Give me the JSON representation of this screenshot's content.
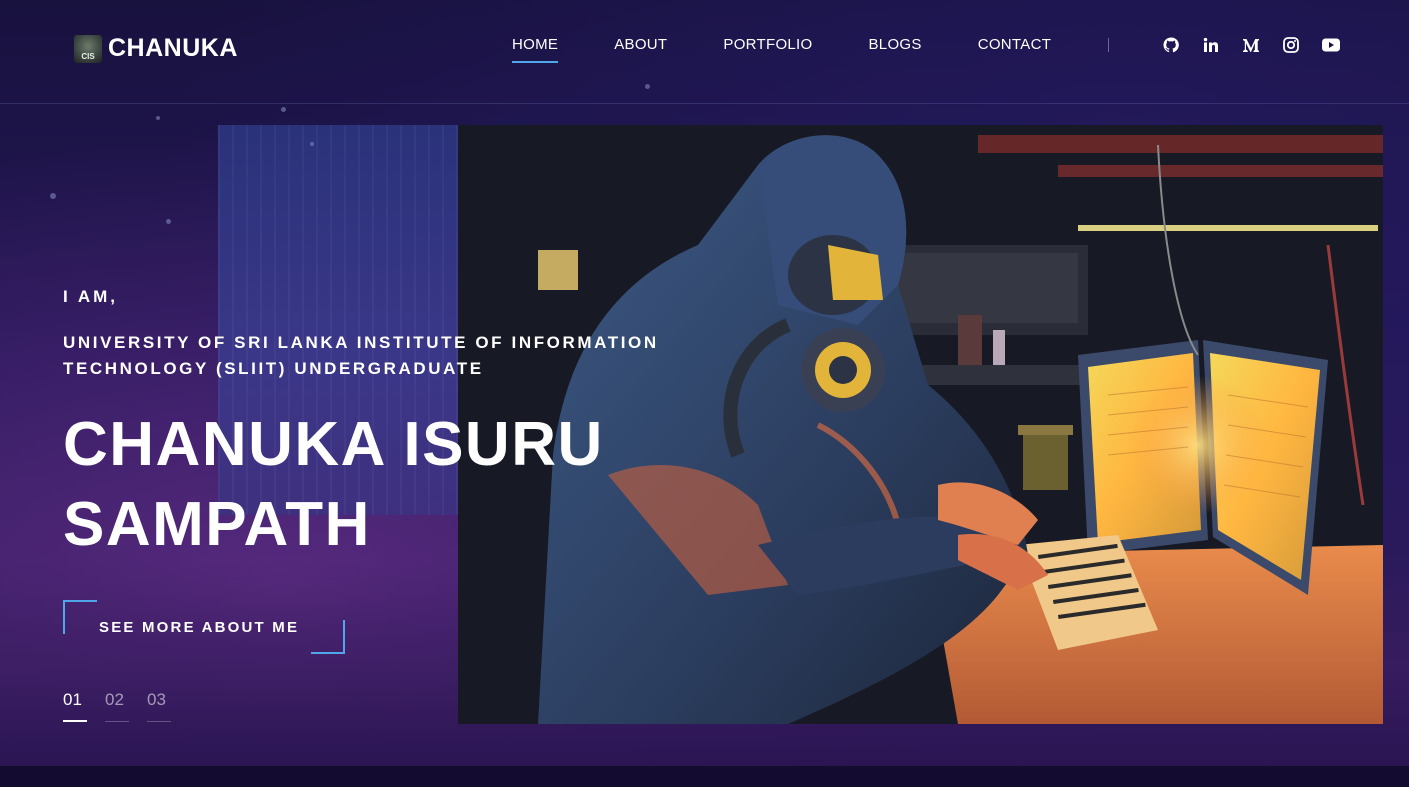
{
  "brand": {
    "badge_text": "CIS",
    "name": "CHANUKA"
  },
  "nav": {
    "items": [
      {
        "label": "HOME",
        "active": true
      },
      {
        "label": "ABOUT",
        "active": false
      },
      {
        "label": "PORTFOLIO",
        "active": false
      },
      {
        "label": "BLOGS",
        "active": false
      },
      {
        "label": "CONTACT",
        "active": false
      }
    ],
    "socials": [
      "github-icon",
      "linkedin-icon",
      "medium-icon",
      "instagram-icon",
      "youtube-icon"
    ]
  },
  "hero": {
    "intro": "I AM,",
    "role": "UNIVERSITY OF SRI LANKA INSTITUTE OF INFORMATION TECHNOLOGY (SLIIT) UNDERGRADUATE",
    "name": "CHANUKA ISURU SAMPATH",
    "cta_label": "SEE MORE ABOUT ME",
    "image": "hooded-hacker-gas-mask-illustration"
  },
  "slider": {
    "items": [
      "01",
      "02",
      "03"
    ],
    "active_index": 0
  },
  "colors": {
    "accent": "#4fa6e8",
    "background": "#1a1240",
    "text": "#ffffff"
  }
}
